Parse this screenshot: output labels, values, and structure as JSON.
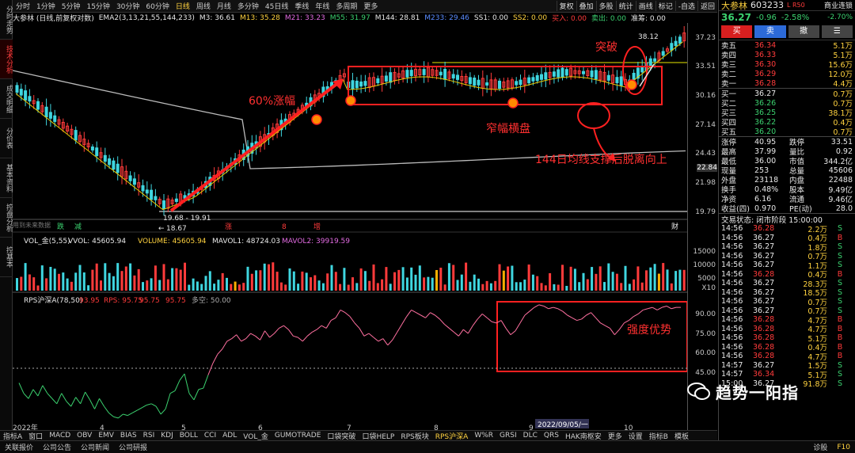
{
  "leftbar": {
    "items": [
      {
        "label": "分时走势"
      },
      {
        "label": "技术分析"
      },
      {
        "label": "成交明细"
      },
      {
        "label": "分价表"
      },
      {
        "label": "基本资料"
      },
      {
        "label": "控盘分析"
      },
      {
        "label": "控基本"
      }
    ]
  },
  "toolbar": {
    "timeframes": [
      {
        "label": "分时"
      },
      {
        "label": "1分钟"
      },
      {
        "label": "5分钟"
      },
      {
        "label": "15分钟"
      },
      {
        "label": "30分钟"
      },
      {
        "label": "60分钟"
      },
      {
        "label": "日线"
      },
      {
        "label": "周线"
      },
      {
        "label": "月线"
      },
      {
        "label": "多分钟"
      },
      {
        "label": "45日线"
      },
      {
        "label": "季线"
      },
      {
        "label": "年线"
      },
      {
        "label": "多周期"
      },
      {
        "label": "更多"
      }
    ],
    "actions": [
      {
        "label": "复权"
      },
      {
        "label": "叠加"
      },
      {
        "label": "多股"
      },
      {
        "label": "统计"
      },
      {
        "label": "画线"
      },
      {
        "label": "标记"
      },
      {
        "label": "-自选"
      },
      {
        "label": "返回"
      }
    ]
  },
  "legend": {
    "stock": "大参林 (日线,前复权对数)",
    "ema": "EMA2(3,13,21,55,144,233)",
    "m3": "M3: 36.61",
    "m13": "M13: 35.28",
    "m21": "M21: 33.23",
    "m55": "M55: 31.97",
    "m144": "M144: 28.81",
    "m233": "M233: 29.46",
    "ss1": "SS1: 0.00",
    "ss2": "SS2: 0.00",
    "buy": "买入: 0.00",
    "sell": "卖出: 0.00",
    "zc": "准筹: 0.00"
  },
  "annotations": {
    "rise": "60%涨幅",
    "breakout": "突破",
    "consolidation": "窄幅横盘",
    "ma144": "144日均线支撑后脱离向上",
    "strength": "强度优势",
    "high_label": "38.12",
    "range_label": "19.68 - 19.91",
    "low_label": "18.67",
    "future_hint": "用到未来数据"
  },
  "chart_data": {
    "type": "candlestick",
    "y_ticks": [
      "37.23",
      "33.51",
      "30.16",
      "27.14",
      "24.43",
      "21.98",
      "19.79"
    ],
    "current_price_tag": "22.84",
    "x_ticks": [
      "2022年",
      "4",
      "5",
      "6",
      "7",
      "8",
      "9",
      "10"
    ],
    "date_cursor": "2022/09/05/一",
    "signals": [
      {
        "label": "跌"
      },
      {
        "label": "减"
      },
      {
        "label": "涨"
      },
      {
        "label": "8"
      },
      {
        "label": "增"
      },
      {
        "label": "财"
      }
    ],
    "volume_legend": {
      "vol": "VOL_金(5,55)",
      "vvol": "VVOL: 45605.94",
      "volume": "VOLUME: 45605.94",
      "mavol1": "MAVOL1: 48724.03",
      "mavol2": "MAVOL2: 39919.59"
    },
    "volume_ticks": [
      "15000",
      "10000",
      "5000",
      "X10"
    ],
    "rps_legend": {
      "name": "RPS沪深A(78,50)",
      "v1": "93.95",
      "rps": "RPS: 95.75",
      "v3": "95.75",
      "v4": "95.75",
      "line": "多空: 50.00"
    },
    "rps_ticks": [
      "90.00",
      "75.00",
      "60.00",
      "45.00"
    ],
    "rps_values": [
      38,
      30,
      26,
      33,
      28,
      36,
      30,
      26,
      22,
      30,
      24,
      20,
      27,
      22,
      31,
      25,
      18,
      26,
      20,
      15,
      12,
      11,
      14,
      13,
      15,
      17,
      19,
      21,
      22,
      20,
      14,
      18,
      30,
      32,
      40,
      45,
      30,
      25,
      33,
      34,
      44,
      53,
      60,
      64,
      70,
      72,
      75,
      70,
      72,
      76,
      74,
      71,
      78,
      73,
      76,
      80,
      82,
      79,
      74,
      73,
      70,
      74,
      77,
      79,
      82,
      80,
      86,
      88,
      94,
      92,
      89,
      84,
      80,
      74,
      76,
      73,
      70,
      72,
      67,
      71,
      77,
      83,
      89,
      94,
      92,
      90,
      88,
      92,
      90,
      87,
      83,
      80,
      77,
      74,
      79,
      76,
      82,
      87,
      91,
      88,
      85,
      84,
      86,
      80,
      75,
      78,
      84,
      90,
      93,
      96,
      98,
      97,
      95,
      96,
      95,
      93,
      90,
      88,
      86,
      87,
      90,
      92,
      88,
      84,
      82,
      80,
      75,
      79,
      84,
      86,
      89,
      91,
      94,
      95,
      96,
      94,
      96,
      97,
      95,
      96,
      96
    ]
  },
  "quote": {
    "name": "大参林",
    "code": "603233",
    "flags": "L R50",
    "industry": "商业连锁",
    "price": "36.27",
    "change": "-0.96",
    "pct": "-2.58%",
    "pct2": "-2.70%",
    "buttons": [
      {
        "label": "买"
      },
      {
        "label": "卖"
      },
      {
        "label": "撤"
      },
      {
        "label": "☰"
      }
    ],
    "asks": [
      {
        "name": "卖五",
        "v": "36.34",
        "q": "5.1万"
      },
      {
        "name": "卖四",
        "v": "36.33",
        "q": "5.1万"
      },
      {
        "name": "卖三",
        "v": "36.30",
        "q": "15.6万"
      },
      {
        "name": "卖二",
        "v": "36.29",
        "q": "12.0万"
      },
      {
        "name": "卖一",
        "v": "36.28",
        "q": "4.4万"
      }
    ],
    "bids": [
      {
        "name": "买一",
        "v": "36.27",
        "q": "0.7万"
      },
      {
        "name": "买二",
        "v": "36.26",
        "q": "0.7万"
      },
      {
        "name": "买三",
        "v": "36.25",
        "q": "38.1万"
      },
      {
        "name": "买四",
        "v": "36.22",
        "q": "0.4万"
      },
      {
        "name": "买五",
        "v": "36.20",
        "q": "0.7万"
      }
    ],
    "stats": [
      {
        "l1": "涨停",
        "v1": "40.95",
        "l2": "跌停",
        "v2": "33.51"
      },
      {
        "l1": "最高",
        "v1": "37.99",
        "l2": "量比",
        "v2": "0.92"
      },
      {
        "l1": "最低",
        "v1": "36.00",
        "l2": "市值",
        "v2": "344.2亿"
      },
      {
        "l1": "现量",
        "v1": "253",
        "l2": "总量",
        "v2": "45606"
      },
      {
        "l1": "外盘",
        "v1": "23118",
        "l2": "内盘",
        "v2": "22488"
      },
      {
        "l1": "换手",
        "v1": "0.48%",
        "l2": "股本",
        "v2": "9.49亿"
      },
      {
        "l1": "净资",
        "v1": "6.16",
        "l2": "流通",
        "v2": "9.46亿"
      },
      {
        "l1": "收益(四)",
        "v1": "0.970",
        "l2": "PE(动)",
        "v2": "28.0"
      }
    ],
    "trade_status": "交易状态: 闭市阶段 15:00:00",
    "ticks": [
      {
        "t": "14:56",
        "p": "36.28",
        "v": "2.2万",
        "s": "S"
      },
      {
        "t": "14:56",
        "p": "36.27",
        "v": "0.4万",
        "s": "B"
      },
      {
        "t": "14:56",
        "p": "36.27",
        "v": "1.8万",
        "s": "S"
      },
      {
        "t": "14:56",
        "p": "36.27",
        "v": "0.7万",
        "s": "S"
      },
      {
        "t": "14:56",
        "p": "36.27",
        "v": "1.1万",
        "s": "S"
      },
      {
        "t": "14:56",
        "p": "36.28",
        "v": "0.4万",
        "s": "B"
      },
      {
        "t": "14:56",
        "p": "36.27",
        "v": "28.3万",
        "s": "S"
      },
      {
        "t": "14:56",
        "p": "36.27",
        "v": "18.5万",
        "s": "S"
      },
      {
        "t": "14:56",
        "p": "36.27",
        "v": "0.7万",
        "s": "S"
      },
      {
        "t": "14:56",
        "p": "36.27",
        "v": "0.7万",
        "s": "S"
      },
      {
        "t": "14:56",
        "p": "36.28",
        "v": "4.7万",
        "s": "B"
      },
      {
        "t": "14:56",
        "p": "36.28",
        "v": "4.7万",
        "s": "B"
      },
      {
        "t": "14:56",
        "p": "36.28",
        "v": "5.1万",
        "s": "B"
      },
      {
        "t": "14:56",
        "p": "36.28",
        "v": "0.4万",
        "s": "B"
      },
      {
        "t": "14:56",
        "p": "36.28",
        "v": "4.7万",
        "s": "B"
      },
      {
        "t": "14:57",
        "p": "36.27",
        "v": "1.5万",
        "s": "S"
      },
      {
        "t": "14:57",
        "p": "36.34",
        "v": "5.1万",
        "s": "S"
      },
      {
        "t": "15:00",
        "p": "36.27",
        "v": "91.8万",
        "s": "S"
      }
    ]
  },
  "indicators": [
    {
      "label": "指标A"
    },
    {
      "label": "窗口"
    },
    {
      "label": "MACD"
    },
    {
      "label": "OBV"
    },
    {
      "label": "EMV"
    },
    {
      "label": "BIAS"
    },
    {
      "label": "RSI"
    },
    {
      "label": "KDJ"
    },
    {
      "label": "BOLL"
    },
    {
      "label": "CCI"
    },
    {
      "label": "ADL"
    },
    {
      "label": "VOL_金"
    },
    {
      "label": "GUMOTRADE"
    },
    {
      "label": "口袋突破"
    },
    {
      "label": "口袋HELP"
    },
    {
      "label": "RPS板块"
    },
    {
      "label": "RPS沪深A"
    },
    {
      "label": "W%R"
    },
    {
      "label": "GRSI"
    },
    {
      "label": "DLC"
    },
    {
      "label": "QRS"
    },
    {
      "label": "HAK南枢安"
    },
    {
      "label": "更多"
    },
    {
      "label": "设置"
    },
    {
      "label": "指标B"
    },
    {
      "label": "模板"
    }
  ],
  "statusbar": {
    "items": [
      {
        "label": "关联报价"
      },
      {
        "label": "公司公告"
      },
      {
        "label": "公司新闻"
      },
      {
        "label": "公司研报"
      }
    ],
    "right": "诊股",
    "fkey": "F10",
    "watermark": "趋势一阳指"
  }
}
